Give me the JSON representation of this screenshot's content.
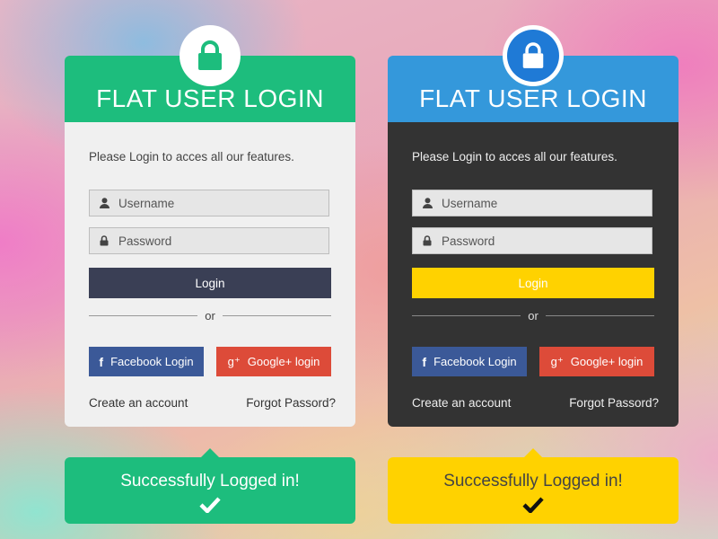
{
  "colors": {
    "green": "#1dbd7d",
    "blue": "#3498db",
    "yellow": "#ffd200",
    "navy": "#3a3f55",
    "facebook": "#3b5998",
    "google": "#dd4b39",
    "dark_panel": "#333333",
    "light_panel": "#f0f0f0"
  },
  "cards": [
    {
      "theme": "light",
      "header_title": "FLAT USER LOGIN",
      "header_color": "#1dbd7d",
      "intro": "Please Login to acces all our features.",
      "username_placeholder": "Username",
      "password_placeholder": "Password",
      "login_label": "Login",
      "or_label": "or",
      "facebook_label": "Facebook Login",
      "google_label": "Google+ login",
      "create_account": "Create an account",
      "forgot_password": "Forgot Passord?",
      "lock_icon": "lock-icon"
    },
    {
      "theme": "dark",
      "header_title": "FLAT USER LOGIN",
      "header_color": "#3498db",
      "intro": "Please Login to acces all our features.",
      "username_placeholder": "Username",
      "password_placeholder": "Password",
      "login_label": "Login",
      "or_label": "or",
      "facebook_label": "Facebook Login",
      "google_label": "Google+ login",
      "create_account": "Create an account",
      "forgot_password": "Forgot Passord?",
      "lock_icon": "lock-icon"
    }
  ],
  "toasts": [
    {
      "message": "Successfully Logged in!",
      "icon": "check-icon"
    },
    {
      "message": "Successfully Logged in!",
      "icon": "check-icon"
    }
  ]
}
